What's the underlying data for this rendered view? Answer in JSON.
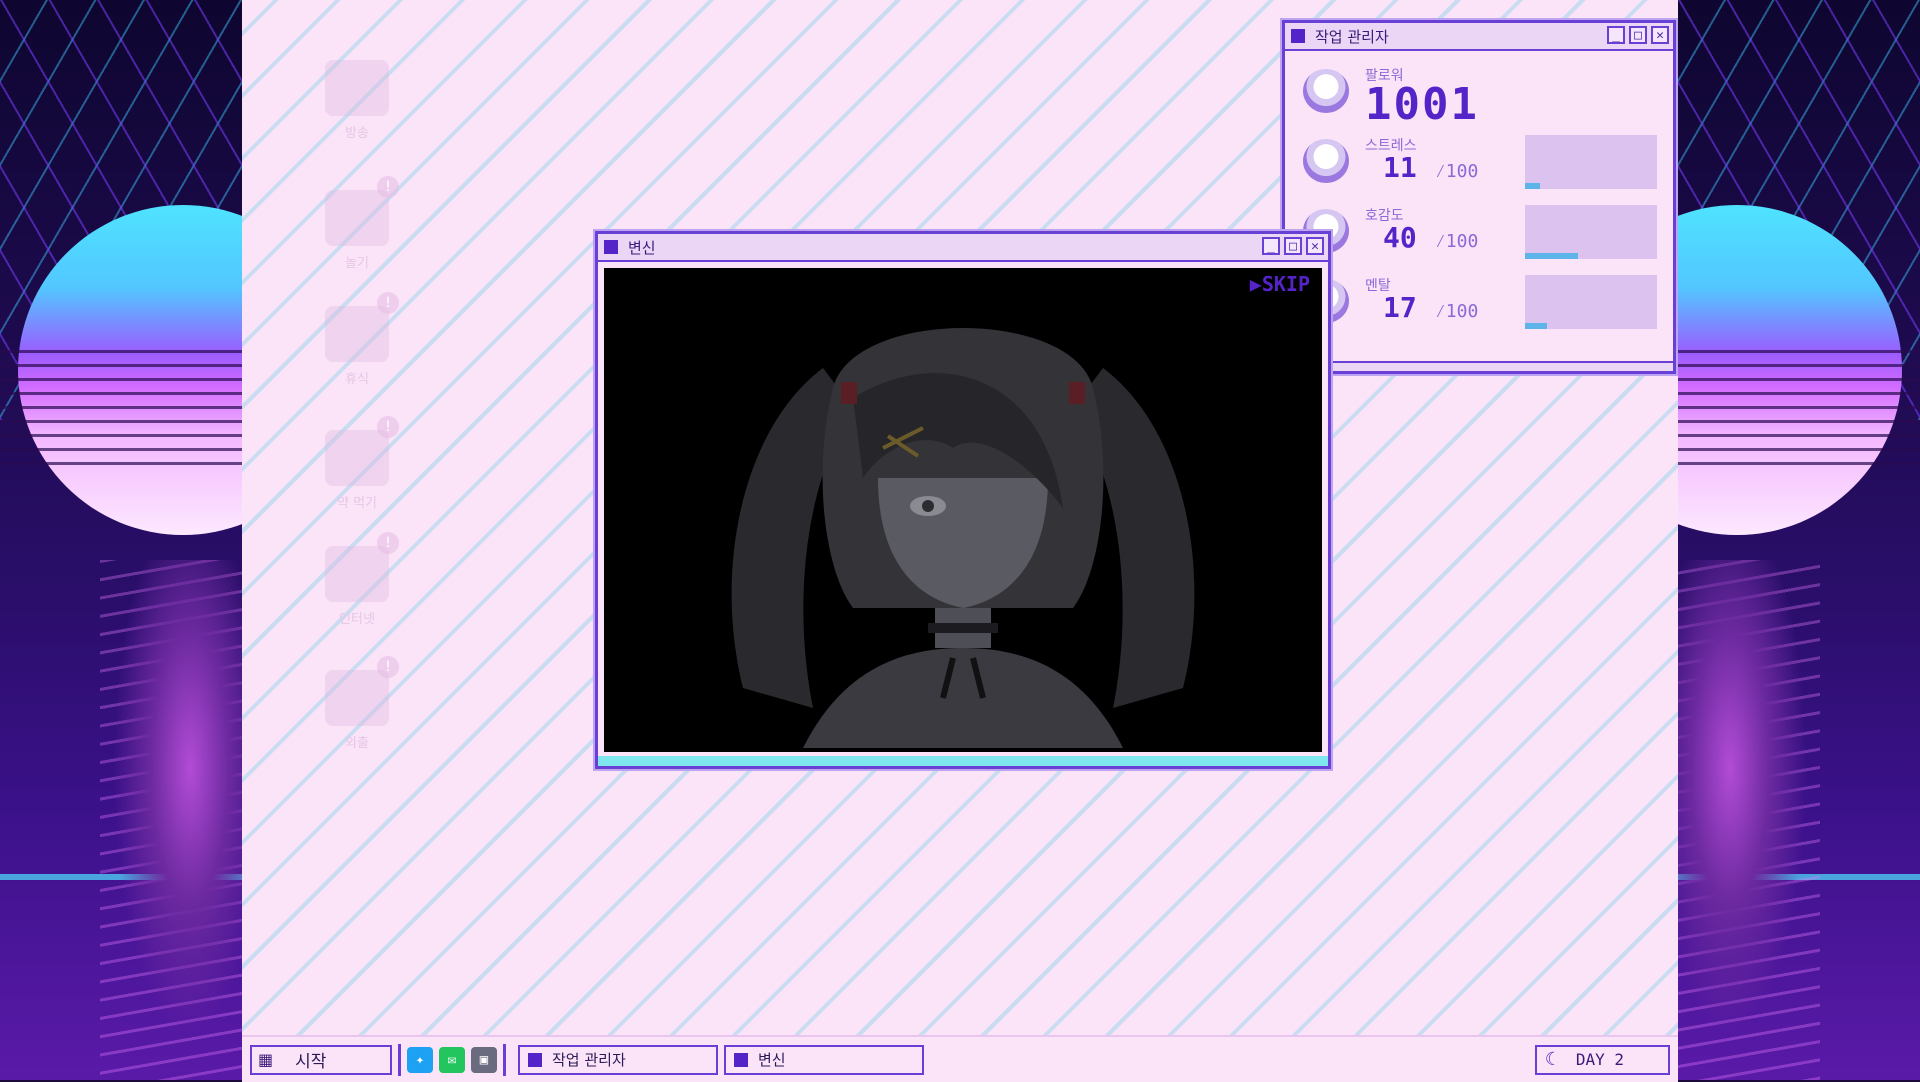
{
  "taskbar": {
    "start_label": "시작",
    "tasks": [
      {
        "label": "작업 관리자"
      },
      {
        "label": "변신"
      }
    ],
    "day_label": "DAY 2",
    "quick_icons": [
      "twitter-icon",
      "chat-icon",
      "computer-icon"
    ]
  },
  "desktop": {
    "icons": [
      {
        "label": "방송",
        "icon": "broadcast-icon",
        "badge": false
      },
      {
        "label": "놀기",
        "icon": "play-icon",
        "badge": true
      },
      {
        "label": "휴식",
        "icon": "sleep-icon",
        "badge": true
      },
      {
        "label": "약 먹기",
        "icon": "medicine-icon",
        "badge": true
      },
      {
        "label": "인터넷",
        "icon": "internet-icon",
        "badge": true
      },
      {
        "label": "외출",
        "icon": "outing-icon",
        "badge": true
      }
    ],
    "badge_glyph": "!"
  },
  "task_manager": {
    "title": "작업 관리자",
    "followers": {
      "label": "팔로워",
      "value": "1001"
    },
    "stress": {
      "label": "스트레스",
      "value": "11",
      "max": "⁄100",
      "level": 0.11
    },
    "affection": {
      "label": "호감도",
      "value": "40",
      "max": "⁄100",
      "level": 0.4
    },
    "mental": {
      "label": "멘탈",
      "value": "17",
      "max": "⁄100",
      "level": 0.17
    }
  },
  "henshin_window": {
    "title": "변신",
    "skip_label": "▶SKIP"
  },
  "window_controls": {
    "minimize": "_",
    "maximize": "□",
    "close": "✕"
  },
  "colors": {
    "accent": "#5524c8",
    "bar_fill": "#5cb4e8",
    "bar_bg": "#dcc2ee"
  }
}
